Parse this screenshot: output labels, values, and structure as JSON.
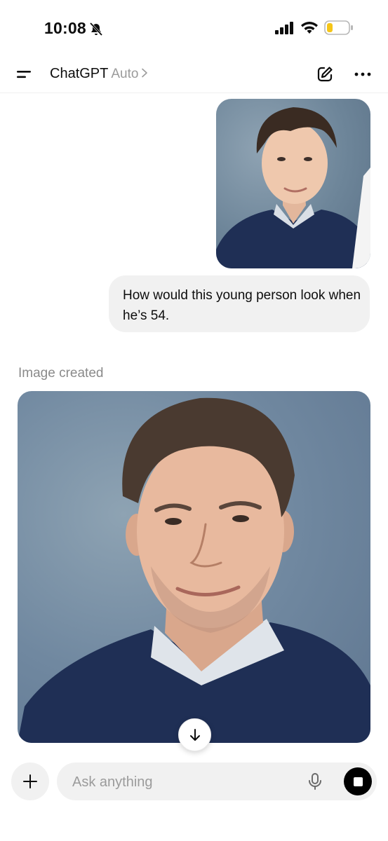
{
  "status_bar": {
    "time": "10:08",
    "icons": [
      "bell-slash-icon",
      "signal-icon",
      "wifi-icon",
      "battery-low-icon"
    ],
    "battery_color": "#f5c518"
  },
  "header": {
    "title": "ChatGPT",
    "model": "Auto",
    "icons": [
      "menu-icon",
      "chevron-right-icon",
      "new-chat-icon",
      "more-icon"
    ]
  },
  "conversation": {
    "user_message": "How would this young person look when he’s 54.",
    "assistant_label": "Image created",
    "scroll_icon": "arrow-down-icon"
  },
  "composer": {
    "placeholder": "Ask anything",
    "icons": [
      "plus-icon",
      "mic-icon",
      "stop-icon"
    ]
  },
  "colors": {
    "bubble_bg": "#f1f1f1",
    "muted_text": "#8a8a8a",
    "image_backdrop": "#6d8599",
    "sweater": "#1f2f55"
  }
}
